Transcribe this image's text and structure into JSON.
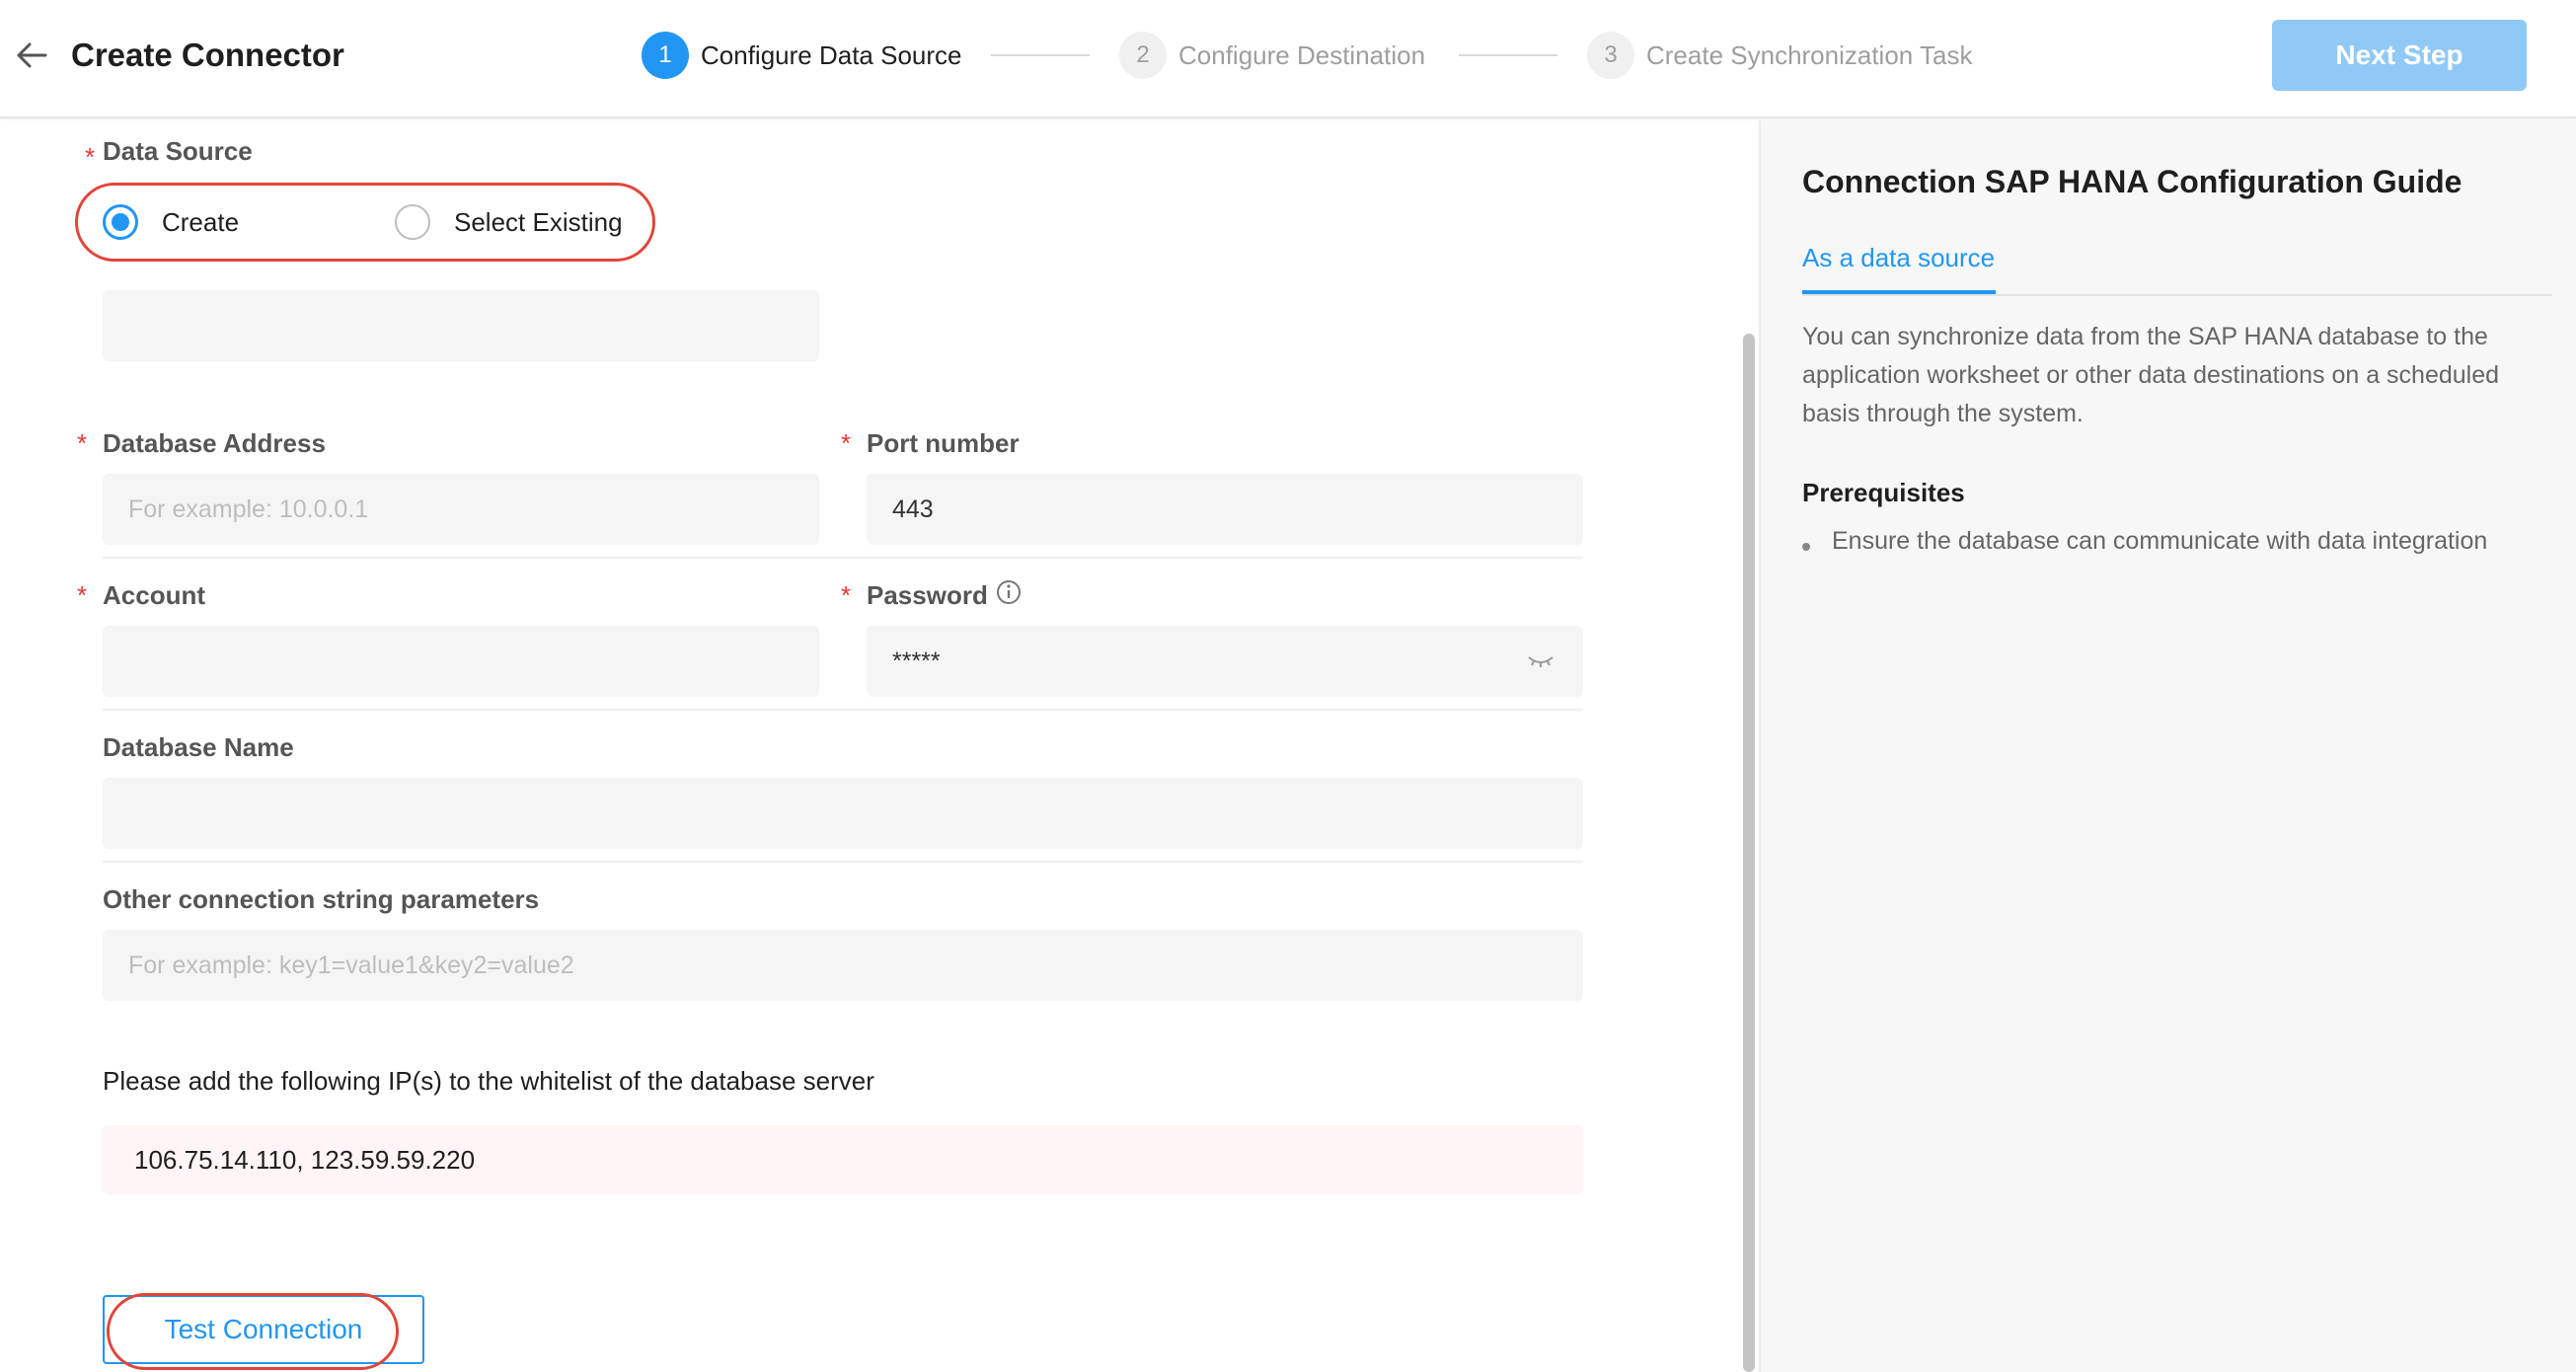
{
  "header": {
    "title": "Create Connector",
    "steps": [
      {
        "num": "1",
        "label": "Configure Data Source"
      },
      {
        "num": "2",
        "label": "Configure Destination"
      },
      {
        "num": "3",
        "label": "Create Synchronization Task"
      }
    ],
    "next_button": "Next Step"
  },
  "form": {
    "data_source": {
      "label": "Data Source",
      "options": [
        "Create",
        "Select Existing"
      ],
      "selected": "Create"
    },
    "database_address": {
      "label": "Database Address",
      "placeholder": "For example: 10.0.0.1",
      "value": ""
    },
    "port_number": {
      "label": "Port number",
      "value": "443"
    },
    "account": {
      "label": "Account",
      "value": ""
    },
    "password": {
      "label": "Password",
      "value": "*****"
    },
    "database_name": {
      "label": "Database Name",
      "value": ""
    },
    "other_params": {
      "label": "Other connection string parameters",
      "placeholder": "For example: key1=value1&key2=value2"
    },
    "whitelist_text": "Please add the following IP(s) to the whitelist of the database server",
    "whitelist_ips": "106.75.14.110, 123.59.59.220",
    "test_button": "Test Connection",
    "required_mark": "*"
  },
  "guide": {
    "title": "Connection SAP HANA Configuration Guide",
    "tab": "As a data source",
    "description": "You can synchronize data from the SAP HANA database to the application worksheet or other data destinations on a scheduled basis through the system.",
    "prerequisites_title": "Prerequisites",
    "prerequisites": [
      "Ensure the database can communicate with data integration"
    ]
  },
  "colors": {
    "accent": "#2196f3",
    "annotation": "#e0463a",
    "next_disabled": "#90c9f6"
  }
}
